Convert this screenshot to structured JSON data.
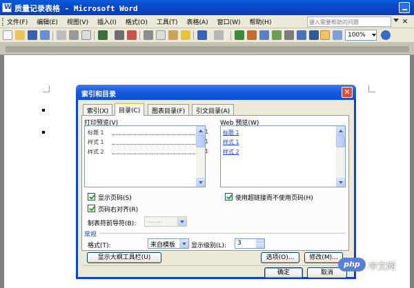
{
  "window": {
    "title": "质量记录表格 - Microsoft Word"
  },
  "menu": {
    "items": [
      "文件(F)",
      "编辑(E)",
      "视图(V)",
      "插入(I)",
      "格式(O)",
      "工具(T)",
      "表格(A)",
      "窗口(W)",
      "帮助(H)"
    ],
    "help_placeholder": "键入需要帮助的问题"
  },
  "toolbar": {
    "zoom": "100%"
  },
  "dialog": {
    "title": "索引和目录",
    "tabs": [
      "索引(X)",
      "目录(C)",
      "图表目录(F)",
      "引文目录(A)"
    ],
    "print_preview": {
      "label": "打印预览(V)",
      "rows": [
        {
          "text": "标题 1",
          "page": "1"
        },
        {
          "text": "样式 1",
          "page": "1"
        },
        {
          "text": "样式 2",
          "page": "1"
        }
      ]
    },
    "web_preview": {
      "label": "Web 预览(W)",
      "links": [
        "标题 1",
        "样式 1",
        "样式 2"
      ]
    },
    "show_page_numbers": "显示页码(S)",
    "right_align": "页码右对齐(R)",
    "use_hyperlinks": "使用超链接而不使用页码(H)",
    "tab_leader_label": "制表符前导符(B):",
    "tab_leader_value": "........",
    "general_label": "常规",
    "formats_label": "格式(T):",
    "formats_value": "来自模板",
    "show_levels_label": "显示级别(L):",
    "show_levels_value": "3",
    "outline_button": "显示大纲工具栏(U)",
    "options_button": "选项(O)...",
    "modify_button": "修改(M)...",
    "ok_button": "确定",
    "cancel_button": "取消"
  },
  "watermark": {
    "badge": "php",
    "text": "中文网"
  }
}
